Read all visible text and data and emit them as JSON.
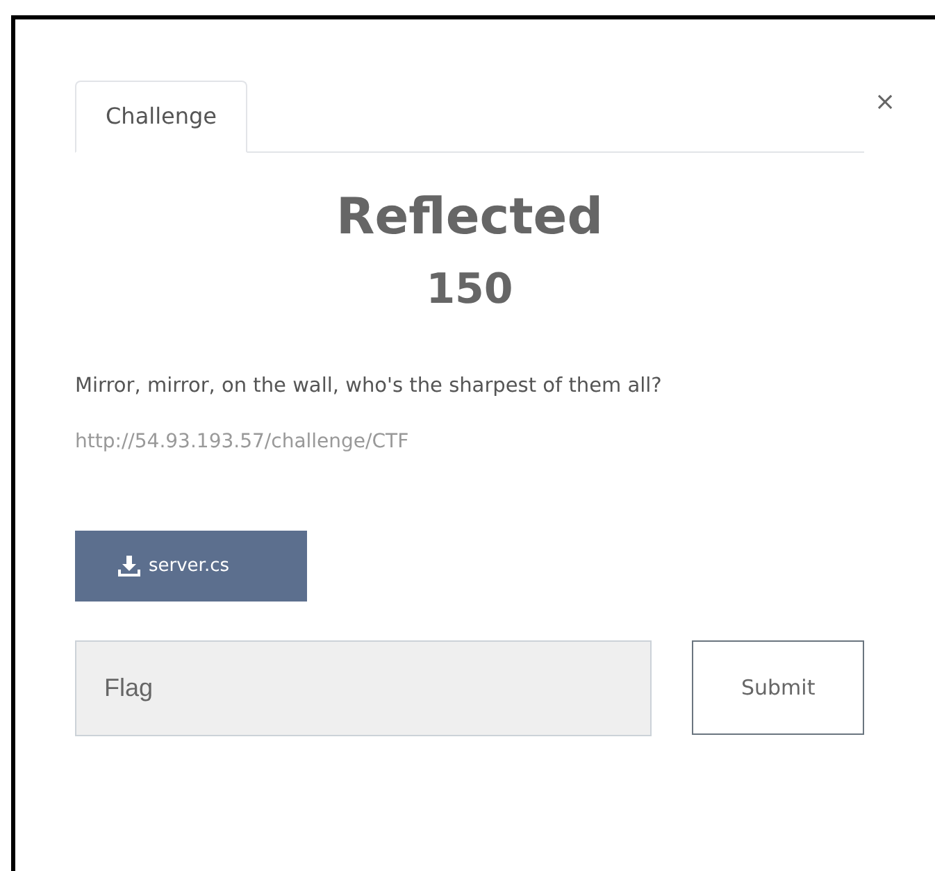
{
  "tabs": [
    {
      "label": "Challenge",
      "selected": true
    }
  ],
  "close": "×",
  "challenge": {
    "name": "Reflected",
    "points": "150",
    "description": "Mirror, mirror, on the wall, who's the sharpest of them all?",
    "url": "http://54.93.193.57/challenge/CTF"
  },
  "files": [
    {
      "label": "server.cs"
    }
  ],
  "flag_field": {
    "placeholder": "Flag"
  },
  "submit": "Submit"
}
